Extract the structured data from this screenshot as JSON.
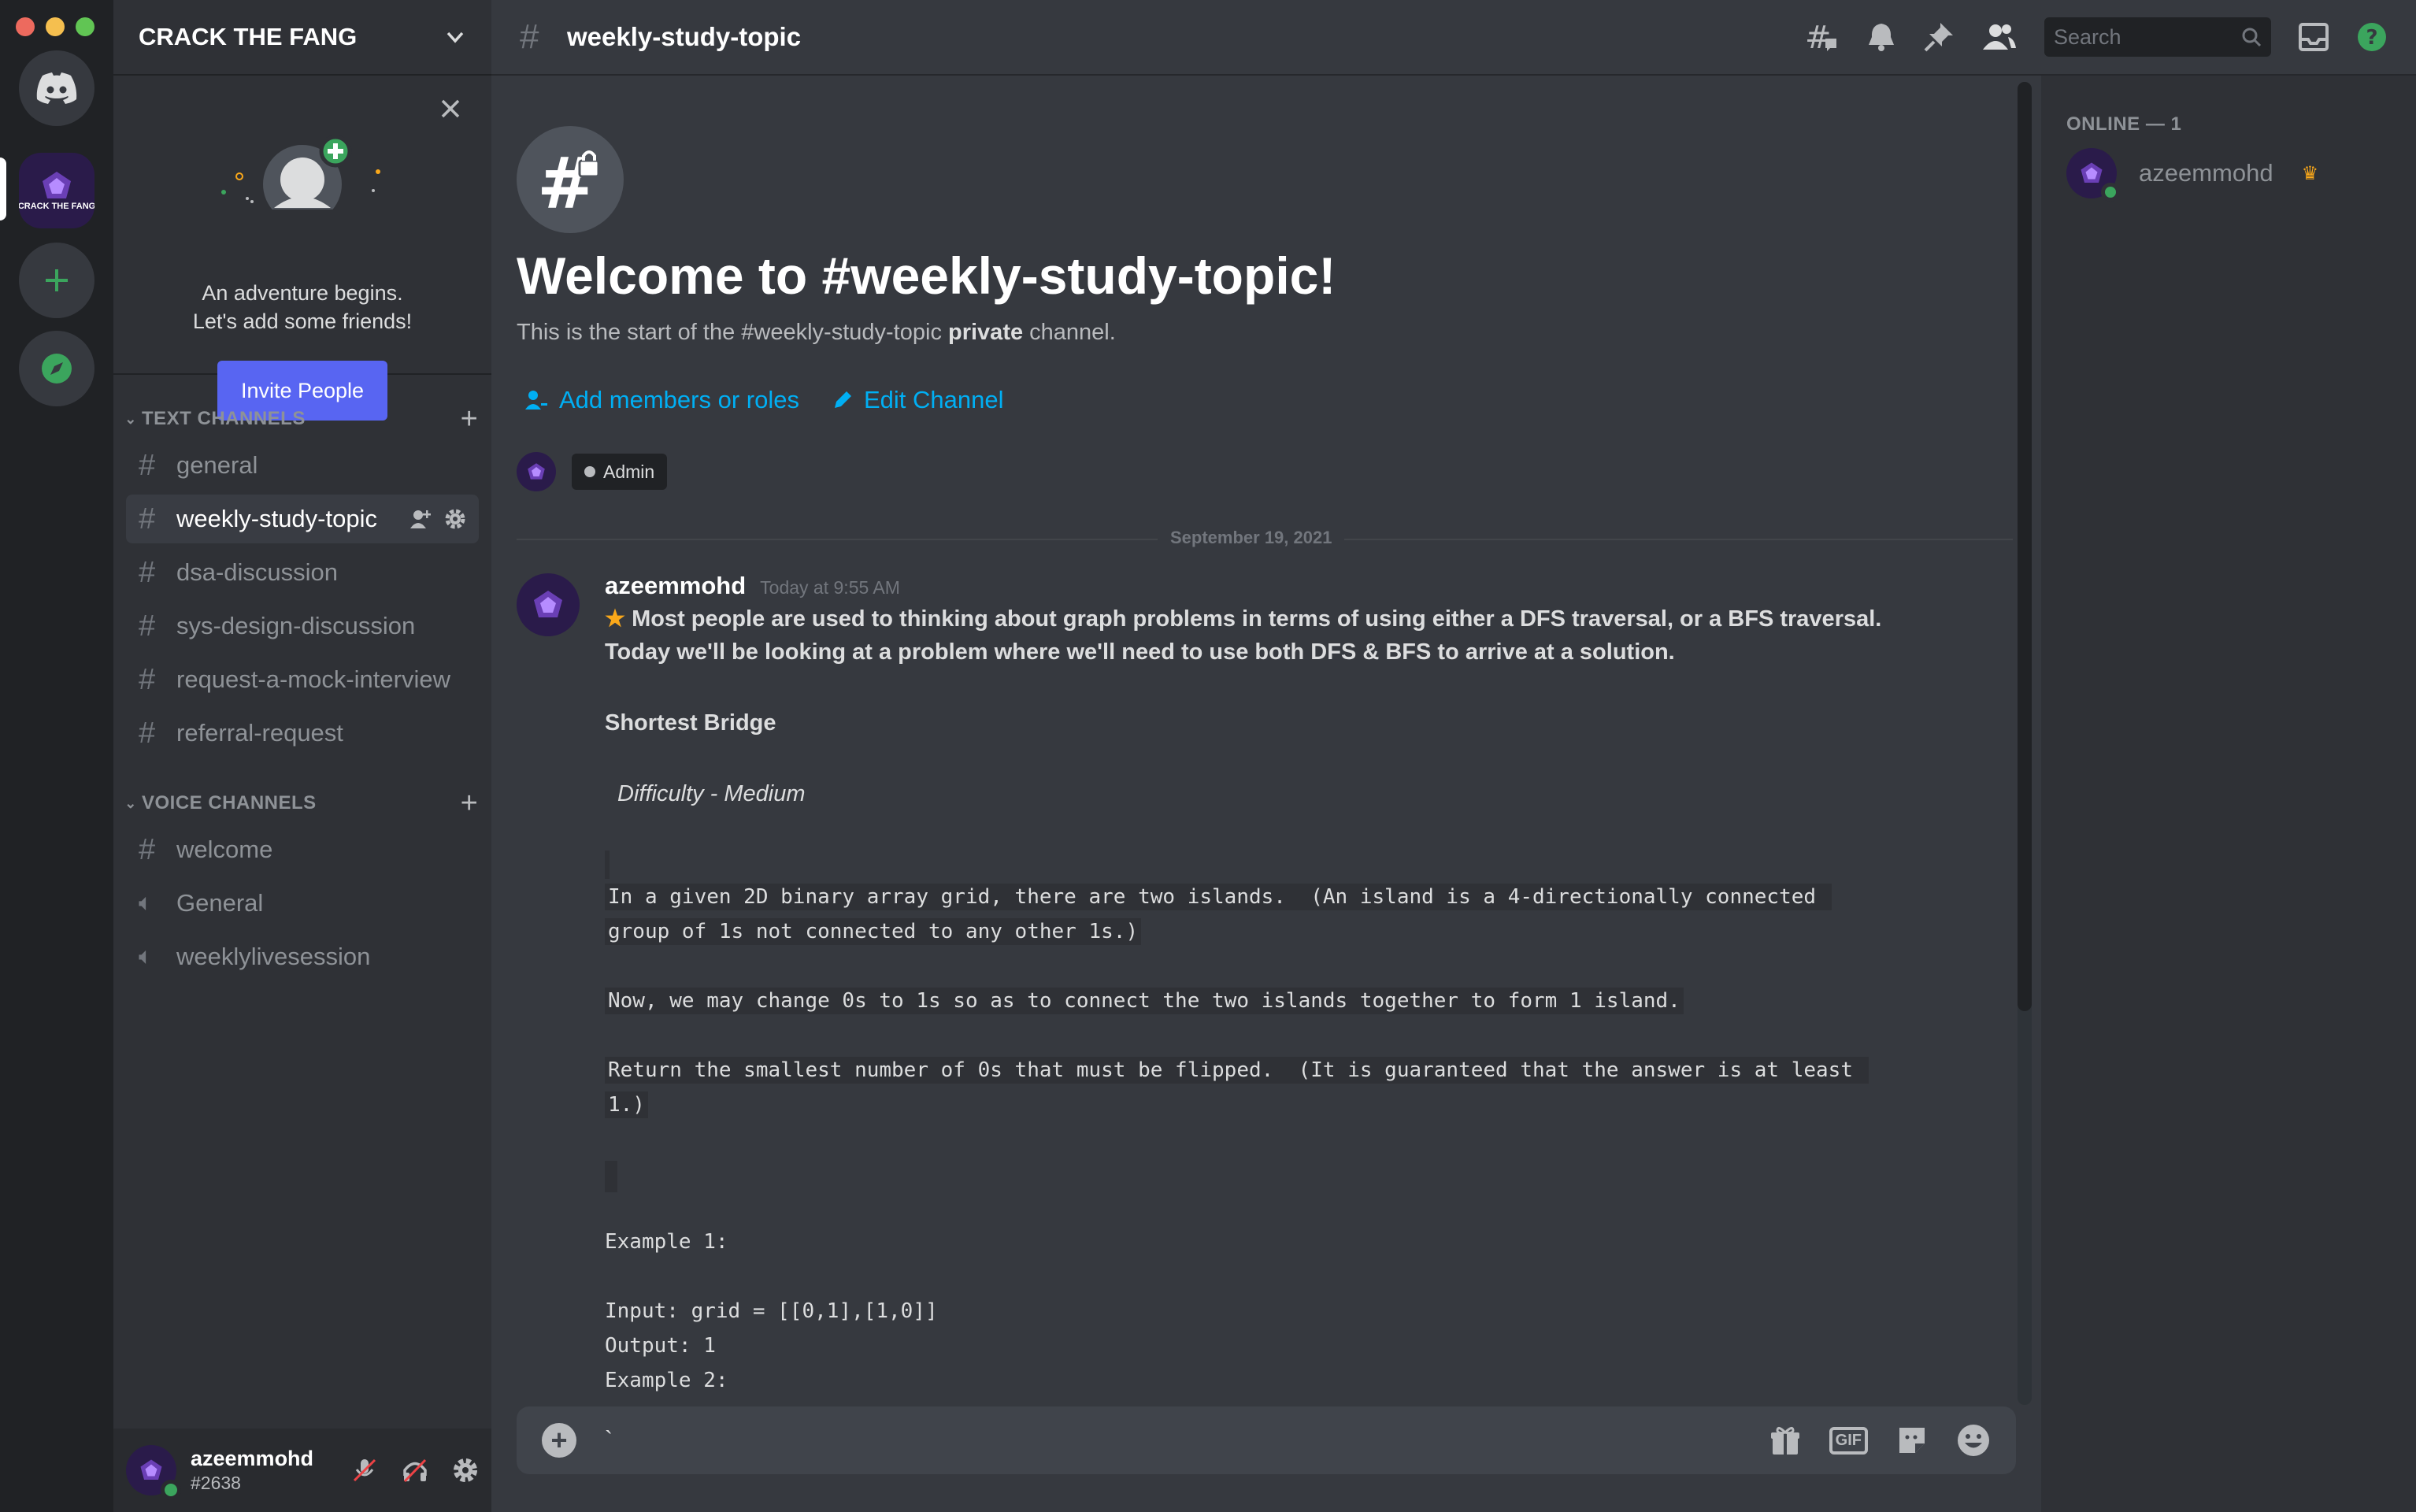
{
  "window": {
    "traffic_lights": [
      "#ed6a5e",
      "#f5bf4f",
      "#61c554"
    ]
  },
  "rail": {
    "home_icon": "discord-logo-icon",
    "server_label": "CRACK THE FANG",
    "add_icon": "plus-icon",
    "explore_icon": "compass-icon"
  },
  "guild": {
    "name": "CRACK THE FANG"
  },
  "invite_card": {
    "line1": "An adventure begins.",
    "line2": "Let's add some friends!",
    "button": "Invite People"
  },
  "text_category": "TEXT CHANNELS",
  "voice_category": "VOICE CHANNELS",
  "text_channels": [
    {
      "name": "general"
    },
    {
      "name": "weekly-study-topic"
    },
    {
      "name": "dsa-discussion"
    },
    {
      "name": "sys-design-discussion"
    },
    {
      "name": "request-a-mock-interview"
    },
    {
      "name": "referral-request"
    }
  ],
  "voice_channels": [
    {
      "name": "welcome"
    },
    {
      "name": "General"
    },
    {
      "name": "weeklylivesession"
    }
  ],
  "user": {
    "name": "azeemmohd",
    "tag": "#2638"
  },
  "header": {
    "channel": "weekly-study-topic",
    "search_placeholder": "Search"
  },
  "welcome": {
    "title": "Welcome to #weekly-study-topic!",
    "sub_before": "This is the start of the #weekly-study-topic ",
    "sub_bold": "private",
    "sub_after": " channel.",
    "add_members": "Add members or roles",
    "edit_channel": "Edit Channel",
    "role": "Admin"
  },
  "date_divider": "September 19, 2021",
  "message": {
    "author": "azeemmohd",
    "timestamp": "Today at 9:55 AM",
    "line1": "Most people are used to thinking about graph problems in terms of using either a DFS traversal, or a BFS traversal.",
    "line2": "Today we'll be looking at a problem where we'll need to use both DFS & BFS to arrive at a solution.",
    "problem_title": "Shortest Bridge",
    "difficulty": "Difficulty - Medium",
    "code1a": "In a given 2D binary array grid, there are two islands.  (An island is a 4-directionally connected ",
    "code1b": "group of 1s not connected to any other 1s.)",
    "code2": "Now, we may change 0s to 1s so as to connect the two islands together to form 1 island.",
    "code3a": "Return the smallest number of 0s that must be flipped.  (It is guaranteed that the answer is at least ",
    "code3b": "1.)",
    "ex1": "Example 1:",
    "input1": "Input: grid = [[0,1],[1,0]]",
    "output1": "Output: 1",
    "ex2": "Example 2:"
  },
  "composer": {
    "draft": "`"
  },
  "members": {
    "heading": "ONLINE — 1",
    "list": [
      {
        "name": "azeemmohd",
        "owner": true
      }
    ]
  },
  "colors": {
    "accent": "#5865f2",
    "link": "#00aff4",
    "online": "#3ba55d",
    "crown": "#faa81a"
  }
}
